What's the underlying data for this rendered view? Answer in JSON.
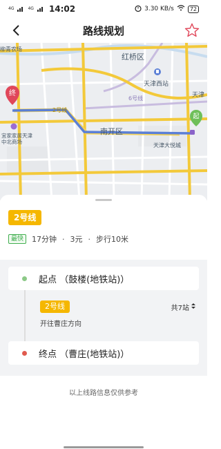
{
  "status_bar": {
    "signal_1": "4G",
    "signal_2": "4G",
    "time": "14:02",
    "speed": "3.30 KB/s",
    "battery": "72"
  },
  "header": {
    "title": "路线规划"
  },
  "map": {
    "labels": {
      "district_hongqiao": "红桥区",
      "station_tianjin_west": "天津西站",
      "station_tianjin_partial": "天津",
      "line6_label": "6号线",
      "line2_label": "2号线",
      "district_nankai": "南开区",
      "mall_yuecheng": "天津大悦城",
      "mall_ikea": "宜家家居天津中北商场",
      "area_top_left": "柳青农场",
      "marker_start": "起",
      "marker_end": "终"
    },
    "colors": {
      "route": "#5b7fd6",
      "major_road": "#f3c93a",
      "metro_line6": "#c8bcdf",
      "metro_line2": "#f3d25b"
    }
  },
  "route": {
    "line_badge": "2号线",
    "fast_tag": "最快",
    "duration": "17分钟",
    "fare": "3元",
    "walk": "步行10米"
  },
  "stops": {
    "start": "起点 （鼓楼(地铁站)）",
    "end": "终点 （曹庄(地铁站)）",
    "line": "2号线",
    "stop_count": "共7站",
    "direction": "开往曹庄方向"
  },
  "disclaimer": "以上线路信息仅供参考"
}
